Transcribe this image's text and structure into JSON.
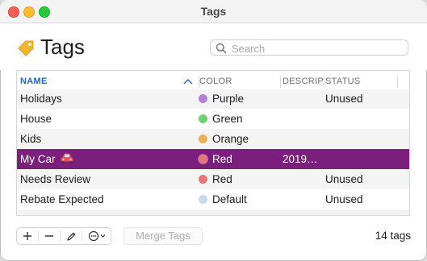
{
  "window": {
    "title": "Tags"
  },
  "header": {
    "title": "Tags",
    "icon": "tag-icon"
  },
  "search": {
    "placeholder": "Search",
    "value": ""
  },
  "table": {
    "columns": [
      {
        "label": "NAME",
        "sorted": "ascending"
      },
      {
        "label": "COLOR"
      },
      {
        "label": "DESCRIP"
      },
      {
        "label": "STATUS"
      }
    ],
    "rows": [
      {
        "name": "Holidays",
        "color": "Purple",
        "color_hex": "#b57fd6",
        "description": "",
        "status": "Unused",
        "selected": false
      },
      {
        "name": "House",
        "color": "Green",
        "color_hex": "#6fcf6f",
        "description": "",
        "status": "",
        "selected": false
      },
      {
        "name": "Kids",
        "color": "Orange",
        "color_hex": "#e8b15a",
        "description": "",
        "status": "",
        "selected": false
      },
      {
        "name": "My Car",
        "emoji": "car",
        "color": "Red",
        "color_hex": "#e8767a",
        "description": "2019…",
        "status": "",
        "selected": true
      },
      {
        "name": "Needs Review",
        "color": "Red",
        "color_hex": "#e8767a",
        "description": "",
        "status": "Unused",
        "selected": false
      },
      {
        "name": "Rebate Expected",
        "color": "Default",
        "color_hex": "#c9d9ef",
        "description": "",
        "status": "Unused",
        "selected": false
      }
    ]
  },
  "toolbar": {
    "add_icon": "plus-icon",
    "remove_icon": "minus-icon",
    "edit_icon": "pencil-icon",
    "more_icon": "ellipsis-circle-icon",
    "merge_label": "Merge Tags"
  },
  "footer": {
    "count": "14 tags"
  },
  "colors": {
    "selection": "#7b1f7c",
    "header_accent": "#1a66c9"
  }
}
